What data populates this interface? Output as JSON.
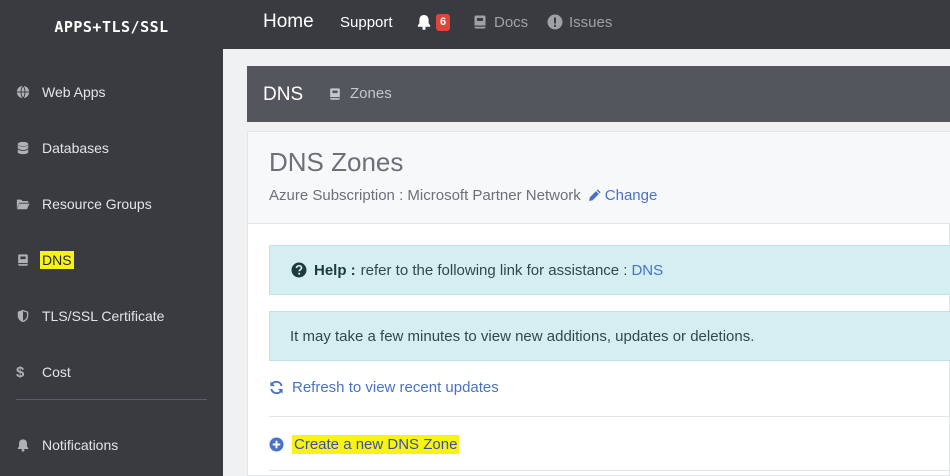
{
  "sidebar": {
    "brand": "APPS+TLS/SSL",
    "items": [
      {
        "label": "Web Apps",
        "icon": "globe-icon"
      },
      {
        "label": "Databases",
        "icon": "database-icon"
      },
      {
        "label": "Resource Groups",
        "icon": "folder-open-icon"
      },
      {
        "label": "DNS",
        "icon": "book-icon",
        "highlighted": true
      },
      {
        "label": "TLS/SSL Certificate",
        "icon": "shield-icon"
      },
      {
        "label": "Cost",
        "icon": "dollar-icon"
      }
    ],
    "footer_item": {
      "label": "Notifications",
      "icon": "bell-icon"
    }
  },
  "topbar": {
    "home": "Home",
    "support": "Support",
    "notification_count": "6",
    "docs": "Docs",
    "issues": "Issues"
  },
  "section": {
    "title": "DNS",
    "tab": "Zones"
  },
  "card": {
    "title": "DNS Zones",
    "subscription_text": "Azure Subscription : Microsoft Partner Network",
    "change_label": "Change",
    "help_label": "Help :",
    "help_text": "refer to the following link for assistance :",
    "help_link": "DNS",
    "info_text": "It may take a few minutes to view new additions, updates or deletions.",
    "refresh_label": "Refresh to view recent updates",
    "create_label": "Create a new DNS Zone"
  },
  "colors": {
    "sidebar_bg": "#393b40",
    "highlight": "#f7f315",
    "link": "#4a72c4",
    "alert_bg": "#d4eef2",
    "badge": "#e0443a"
  }
}
